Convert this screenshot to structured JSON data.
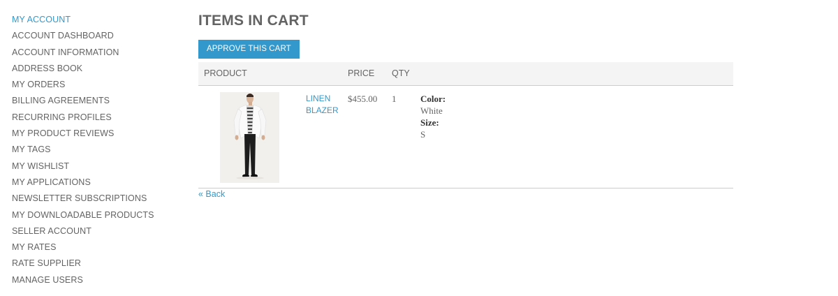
{
  "sidebar": {
    "items": [
      {
        "label": "MY ACCOUNT",
        "active": true
      },
      {
        "label": "ACCOUNT DASHBOARD"
      },
      {
        "label": "ACCOUNT INFORMATION"
      },
      {
        "label": "ADDRESS BOOK"
      },
      {
        "label": "MY ORDERS"
      },
      {
        "label": "BILLING AGREEMENTS"
      },
      {
        "label": "RECURRING PROFILES"
      },
      {
        "label": "MY PRODUCT REVIEWS"
      },
      {
        "label": "MY TAGS"
      },
      {
        "label": "MY WISHLIST"
      },
      {
        "label": "MY APPLICATIONS"
      },
      {
        "label": "NEWSLETTER SUBSCRIPTIONS"
      },
      {
        "label": "MY DOWNLOADABLE PRODUCTS"
      },
      {
        "label": "SELLER ACCOUNT"
      },
      {
        "label": "MY RATES"
      },
      {
        "label": "RATE SUPPLIER"
      },
      {
        "label": "MANAGE USERS"
      }
    ]
  },
  "main": {
    "title": "ITEMS IN CART",
    "approve_button": "APPROVE THIS CART",
    "table": {
      "headers": {
        "product": "PRODUCT",
        "price": "PRICE",
        "qty": "QTY"
      },
      "rows": [
        {
          "name": "LINEN BLAZER",
          "price": "$455.00",
          "qty": "1",
          "options": [
            {
              "label": "Color:",
              "value": "White"
            },
            {
              "label": "Size:",
              "value": "S"
            }
          ]
        }
      ]
    },
    "back_link": "« Back"
  },
  "colors": {
    "accent": "#3399cc",
    "text": "#636363",
    "header_bg": "#f4f4f4"
  }
}
